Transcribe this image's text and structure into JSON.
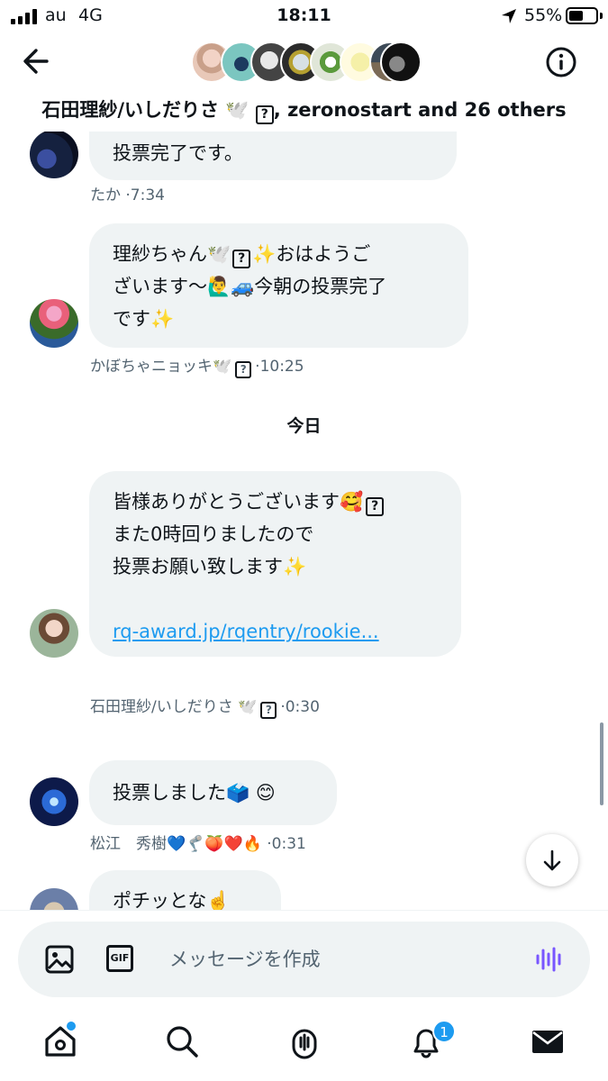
{
  "status_bar": {
    "carrier": "au",
    "network": "4G",
    "time": "18:11",
    "battery_percent": "55%",
    "battery_level": 0.55
  },
  "header": {
    "title": "石田理紗/いしだりさ 🕊️",
    "title_rest": ", zeronostart and 26 others",
    "unknown_glyph": "?",
    "back_icon": "arrow-left-icon",
    "info_icon": "info-circle-icon"
  },
  "messages": [
    {
      "text": "投票完了です。",
      "sender": "たか",
      "time": "·7:34"
    },
    {
      "line1": "理紗ちゃん🕊️",
      "line1_b": "✨おはようご",
      "line2": "ざいます〜🙋‍♂️🚙今朝の投票完了",
      "line3": "です✨",
      "sender": "かぼちゃニョッキ🕊️",
      "time": "·10:25"
    },
    {
      "day_separator": "今日"
    },
    {
      "line1": "皆様ありがとうございます🥰",
      "line2": "また0時回りましたので",
      "line3": "投票お願い致します✨",
      "link": "rq-award.jp/rqentry/rookie...",
      "sender": "石田理紗/いしだりさ 🕊️",
      "time": "·0:30"
    },
    {
      "text": "投票しました🗳️ 😊",
      "sender": "松江　秀樹💙🦿🍑❤️🔥",
      "time": "·0:31"
    },
    {
      "text": "ポチッとな☝️"
    }
  ],
  "composer": {
    "placeholder": "メッセージを作成",
    "gif_label": "GIF",
    "image_icon": "image-icon",
    "voice_icon": "voice-wave-icon"
  },
  "tabbar": {
    "items": [
      "home-icon",
      "search-icon",
      "spaces-icon",
      "notifications-icon",
      "messages-icon"
    ],
    "notification_count": "1"
  },
  "colors": {
    "accent": "#1d9bf0",
    "bubble": "#eff3f4",
    "meta_text": "#536471",
    "voice": "#7856ff"
  }
}
